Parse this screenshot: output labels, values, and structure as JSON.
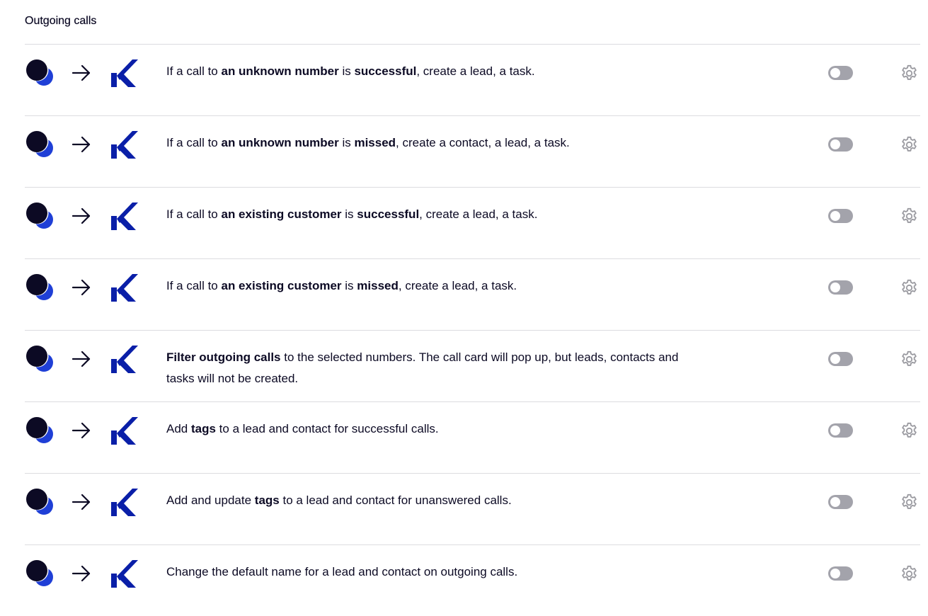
{
  "section_title": "Outgoing calls",
  "colors": {
    "dark": "#0c0a24",
    "accent_blue": "#1f3fd6",
    "kommo_blue": "#0a1fa8",
    "toggle_off": "#a3a3ab",
    "gear_gray": "#9a9aa0",
    "divider": "#dcdce0"
  },
  "icons": {
    "source": "telephony-provider-logo",
    "arrow": "arrow-right-icon",
    "target": "kommo-logo",
    "settings": "gear-icon"
  },
  "rules": [
    {
      "segments": [
        {
          "text": "If a call to ",
          "bold": false
        },
        {
          "text": "an unknown number",
          "bold": true
        },
        {
          "text": " is ",
          "bold": false
        },
        {
          "text": "successful",
          "bold": true
        },
        {
          "text": ", create a lead, a task.",
          "bold": false
        }
      ],
      "enabled": false
    },
    {
      "segments": [
        {
          "text": "If a call to ",
          "bold": false
        },
        {
          "text": "an unknown number",
          "bold": true
        },
        {
          "text": " is ",
          "bold": false
        },
        {
          "text": "missed",
          "bold": true
        },
        {
          "text": ", create a contact, a lead, a task.",
          "bold": false
        }
      ],
      "enabled": false
    },
    {
      "segments": [
        {
          "text": "If a call to ",
          "bold": false
        },
        {
          "text": "an existing customer",
          "bold": true
        },
        {
          "text": " is ",
          "bold": false
        },
        {
          "text": "successful",
          "bold": true
        },
        {
          "text": ", create a lead, a task.",
          "bold": false
        }
      ],
      "enabled": false
    },
    {
      "segments": [
        {
          "text": "If a call to ",
          "bold": false
        },
        {
          "text": "an existing customer",
          "bold": true
        },
        {
          "text": " is ",
          "bold": false
        },
        {
          "text": "missed",
          "bold": true
        },
        {
          "text": ", create a lead, a task.",
          "bold": false
        }
      ],
      "enabled": false
    },
    {
      "segments": [
        {
          "text": "Filter outgoing calls",
          "bold": true
        },
        {
          "text": " to the selected numbers. The call card will pop up, but leads, contacts and tasks will not be created.",
          "bold": false
        }
      ],
      "enabled": false
    },
    {
      "segments": [
        {
          "text": "Add ",
          "bold": false
        },
        {
          "text": "tags",
          "bold": true
        },
        {
          "text": " to a lead and contact for successful calls.",
          "bold": false
        }
      ],
      "enabled": false
    },
    {
      "segments": [
        {
          "text": "Add and update ",
          "bold": false
        },
        {
          "text": "tags",
          "bold": true
        },
        {
          "text": " to a lead and contact for unanswered calls.",
          "bold": false
        }
      ],
      "enabled": false
    },
    {
      "segments": [
        {
          "text": "Change the default name for a lead and contact on outgoing calls.",
          "bold": false
        }
      ],
      "enabled": false
    }
  ]
}
